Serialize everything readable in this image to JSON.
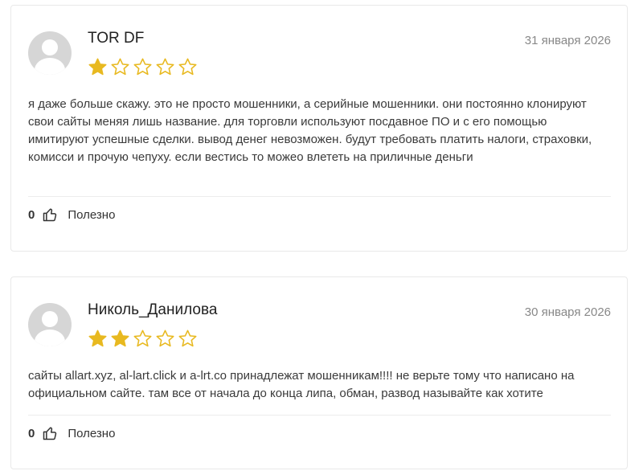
{
  "colors": {
    "star_filled": "#E8B920",
    "star_empty": "#E8B920",
    "avatar_bg": "#d6d6d6"
  },
  "reviews": [
    {
      "author": "TOR DF",
      "date": "31 января 2026",
      "rating": 1,
      "rating_max": 5,
      "text": "я даже больше скажу. это не просто мошенники, а серийные мошенники. они постоянно клонируют свои сайты меняя лишь название. для торговли используют посдавное ПО и с его помощью имитируют успешные сделки. вывод денег невозможен. будут требовать платить налоги, страховки, комисси и прочую чепуху. если вестись то можео влететь на приличные деньги",
      "likes": "0",
      "useful_label": "Полезно"
    },
    {
      "author": "Николь_Данилова",
      "date": "30 января 2026",
      "rating": 2,
      "rating_max": 5,
      "text": "сайты allart.xyz, al-lart.click и a-lrt.co принадлежат мошенникам!!!! не верьте тому что написано на официальном сайте. там все от начала до конца липа, обман, развод называйте как хотите",
      "likes": "0",
      "useful_label": "Полезно"
    }
  ]
}
